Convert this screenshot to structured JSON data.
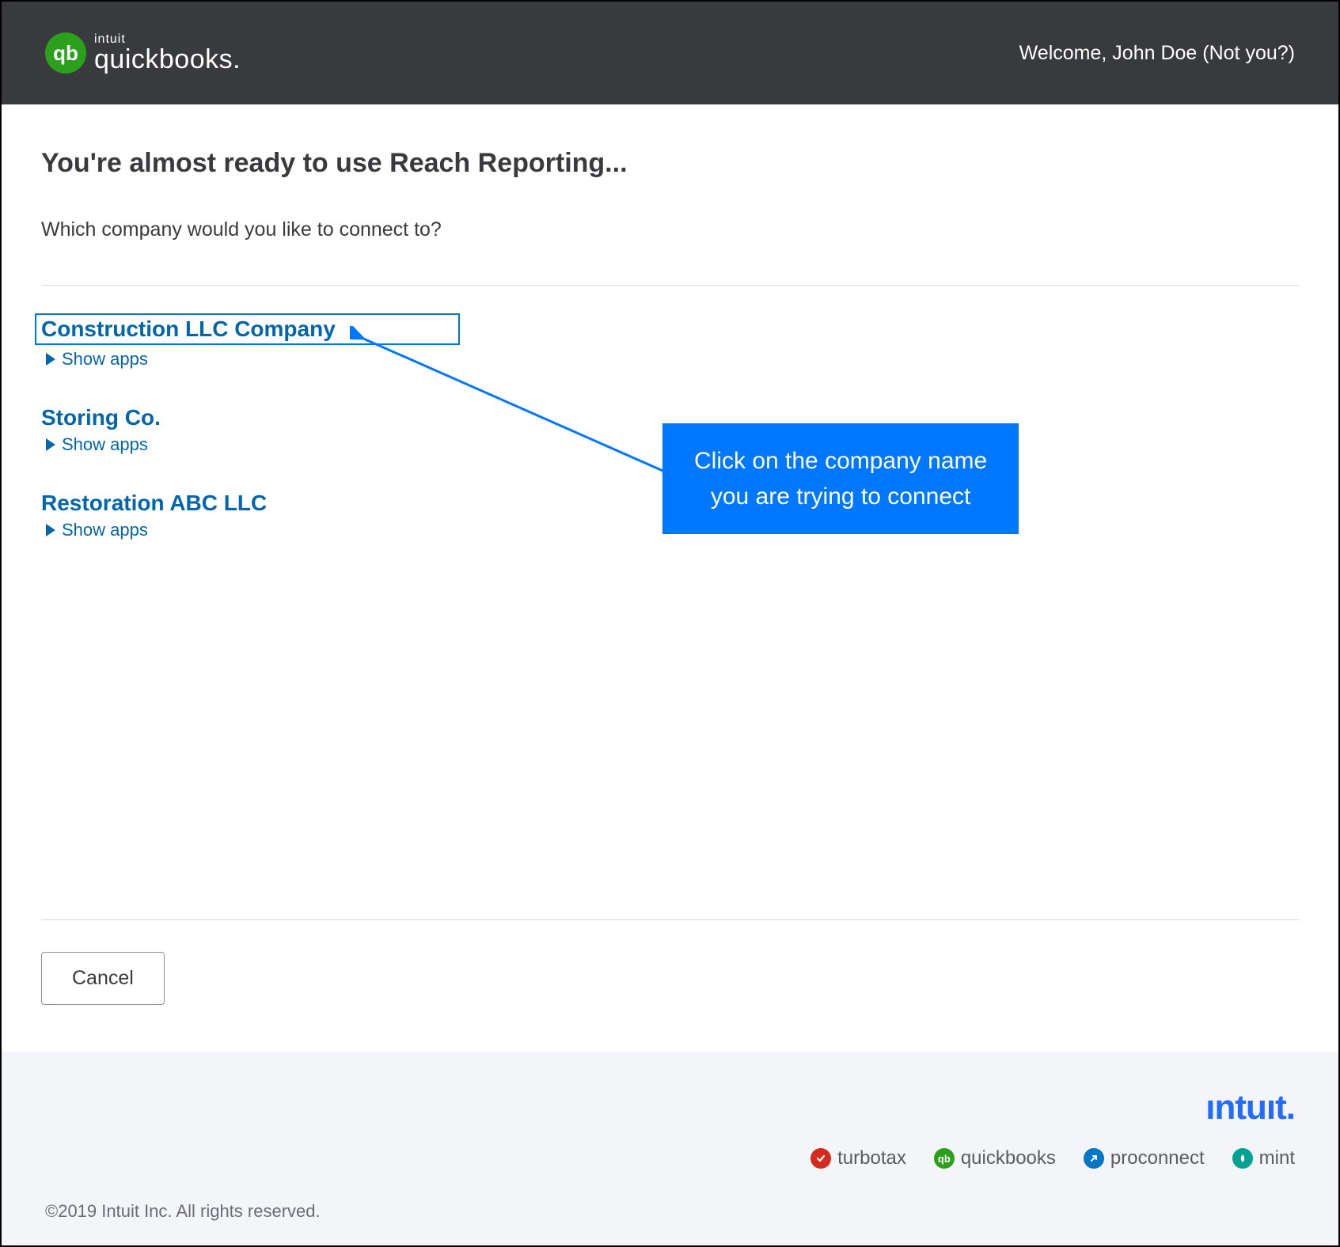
{
  "header": {
    "logo_top": "intuit",
    "logo_bottom": "quickbooks.",
    "logo_badge": "qb",
    "welcome_prefix": "Welcome, ",
    "user_name": "John Doe",
    "not_you": " (Not you?)"
  },
  "main": {
    "title": "You're almost ready to use Reach Reporting...",
    "subtitle": "Which company would you like to connect to?",
    "companies": [
      {
        "name": "Construction LLC Company",
        "show_apps": "Show apps"
      },
      {
        "name": "Storing Co.",
        "show_apps": "Show apps"
      },
      {
        "name": "Restoration ABC LLC",
        "show_apps": "Show apps"
      }
    ],
    "cancel_label": "Cancel"
  },
  "callout": {
    "line1": "Click on the company name",
    "line2": "you are trying to connect"
  },
  "footer": {
    "intuit_logo": "ıntuıt.",
    "brands": {
      "turbotax": "turbotax",
      "quickbooks": "quickbooks",
      "proconnect": "proconnect",
      "mint": "mint"
    },
    "copyright": "©2019 Intuit Inc. All rights reserved."
  }
}
